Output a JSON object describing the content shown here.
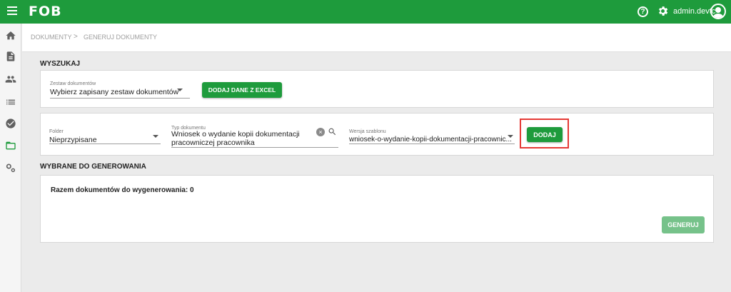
{
  "header": {
    "logo": "FOB",
    "user_name": "admin.devtc"
  },
  "sidebar": {
    "items": [
      {
        "icon": "home-icon"
      },
      {
        "icon": "document-icon"
      },
      {
        "icon": "users-icon"
      },
      {
        "icon": "list-icon"
      },
      {
        "icon": "check-circle-icon"
      },
      {
        "icon": "folder-open-icon",
        "active": true
      },
      {
        "icon": "settings-icon"
      }
    ]
  },
  "breadcrumb": {
    "item1": "DOKUMENTY",
    "separator": ">",
    "item2": "GENERUJ DOKUMENTY"
  },
  "search_section": {
    "title": "WYSZUKAJ",
    "document_set": {
      "label": "Zestaw dokumentów",
      "value": "Wybierz zapisany zestaw dokumentów"
    },
    "excel_button": "DODAJ DANE Z EXCEL"
  },
  "document_row": {
    "folder": {
      "label": "Folder",
      "value": "Nieprzypisane"
    },
    "document_type": {
      "label": "Typ dokumentu",
      "value_line1": "Wniosek o wydanie kopii dokumentacji",
      "value_line2": "pracowniczej pracownika"
    },
    "template_version": {
      "label": "Wersja szablonu",
      "value": "wniosek-o-wydanie-kopii-dokumentacji-pracownic..."
    },
    "add_button": "DODAJ"
  },
  "selected_section": {
    "title": "WYBRANE DO GENEROWANIA",
    "total_text": "Razem dokumentów do wygenerowania: 0",
    "generate_button": "GENERUJ"
  },
  "colors": {
    "primary": "#1e9b3c",
    "primary_disabled": "#76c28a",
    "highlight": "#e53935"
  }
}
